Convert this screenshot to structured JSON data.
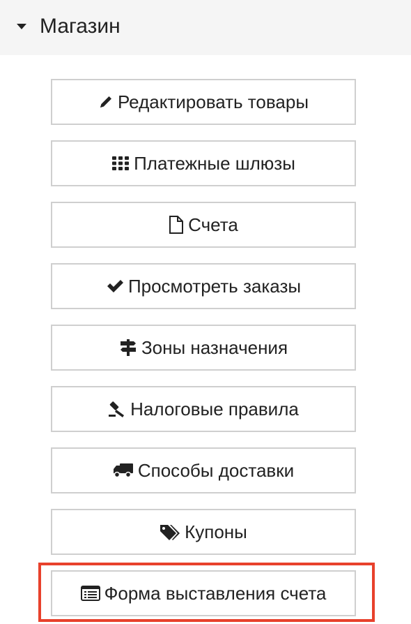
{
  "section": {
    "title": "Магазин",
    "toggle_icon": "caret-down-icon"
  },
  "buttons": [
    {
      "label": "Редактировать товары",
      "icon": "pencil-icon"
    },
    {
      "label": "Платежные шлюзы",
      "icon": "grid-icon"
    },
    {
      "label": "Счета",
      "icon": "document-icon"
    },
    {
      "label": "Просмотреть заказы",
      "icon": "checkmark-icon"
    },
    {
      "label": "Зоны назначения",
      "icon": "signpost-icon"
    },
    {
      "label": "Налоговые правила",
      "icon": "gavel-icon"
    },
    {
      "label": "Способы доставки",
      "icon": "truck-icon"
    },
    {
      "label": "Купоны",
      "icon": "tags-icon"
    },
    {
      "label": "Форма выставления счета",
      "icon": "list-alt-icon"
    }
  ],
  "highlight_color": "#e8412c"
}
